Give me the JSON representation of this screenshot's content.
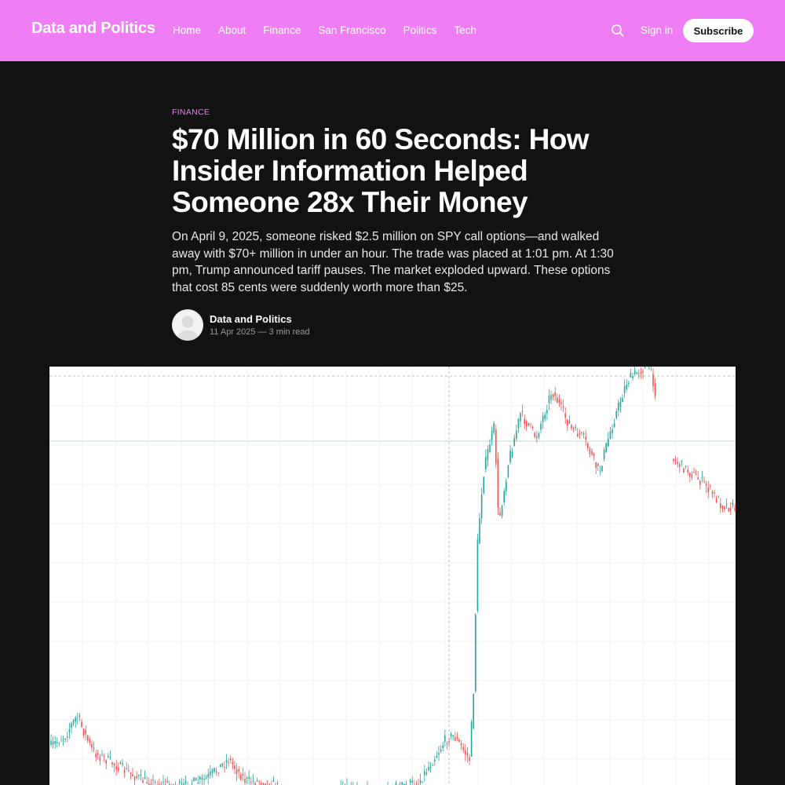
{
  "header": {
    "site_title": "Data and Politics",
    "nav": [
      "Home",
      "About",
      "Finance",
      "San Francisco",
      "Politics",
      "Tech"
    ],
    "search_icon": "search-icon",
    "signin_label": "Sign in",
    "subscribe_label": "Subscribe",
    "bar_color": "#ef7df3"
  },
  "article": {
    "tag": "FINANCE",
    "title": "$70 Million in 60 Seconds: How Insider Information Helped Someone 28x Their Money",
    "excerpt": "On April 9, 2025, someone risked $2.5 million on SPY call options—and walked away with $70+ million in under an hour. The trade was placed at 1:01 pm. At 1:30 pm, Trump announced tariff pauses. The market exploded upward. These options that cost 85 cents were suddenly worth more than $25.",
    "author": "Data and Politics",
    "meta": "11 Apr 2025 — 3 min read",
    "avatar_icon": "user-avatar-icon"
  },
  "chart": {
    "type": "candlestick",
    "up_color": "#26a69a",
    "down_color": "#ef5350"
  }
}
